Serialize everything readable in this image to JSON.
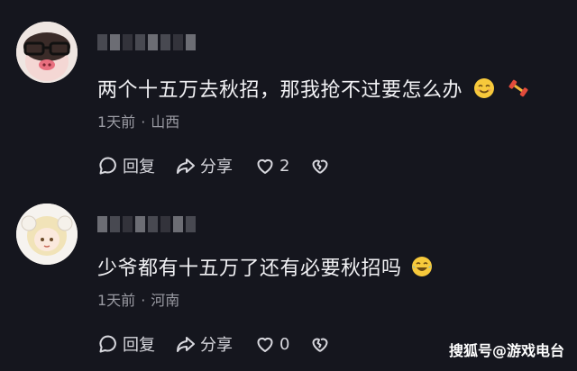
{
  "comments": [
    {
      "text": "两个十五万去秋招，那我抢不过要怎么办",
      "emoji": [
        "smile-icon",
        "dumbbell-icon"
      ],
      "time": "1天前",
      "location": "山西",
      "reply_label": "回复",
      "share_label": "分享",
      "likes": "2"
    },
    {
      "text": "少爷都有十五万了还有必要秋招吗",
      "emoji": [
        "laugh-cry-icon"
      ],
      "time": "1天前",
      "location": "河南",
      "reply_label": "回复",
      "share_label": "分享",
      "likes": "0"
    }
  ],
  "meta_separator": "·",
  "watermark": "搜狐号@游戏电台"
}
